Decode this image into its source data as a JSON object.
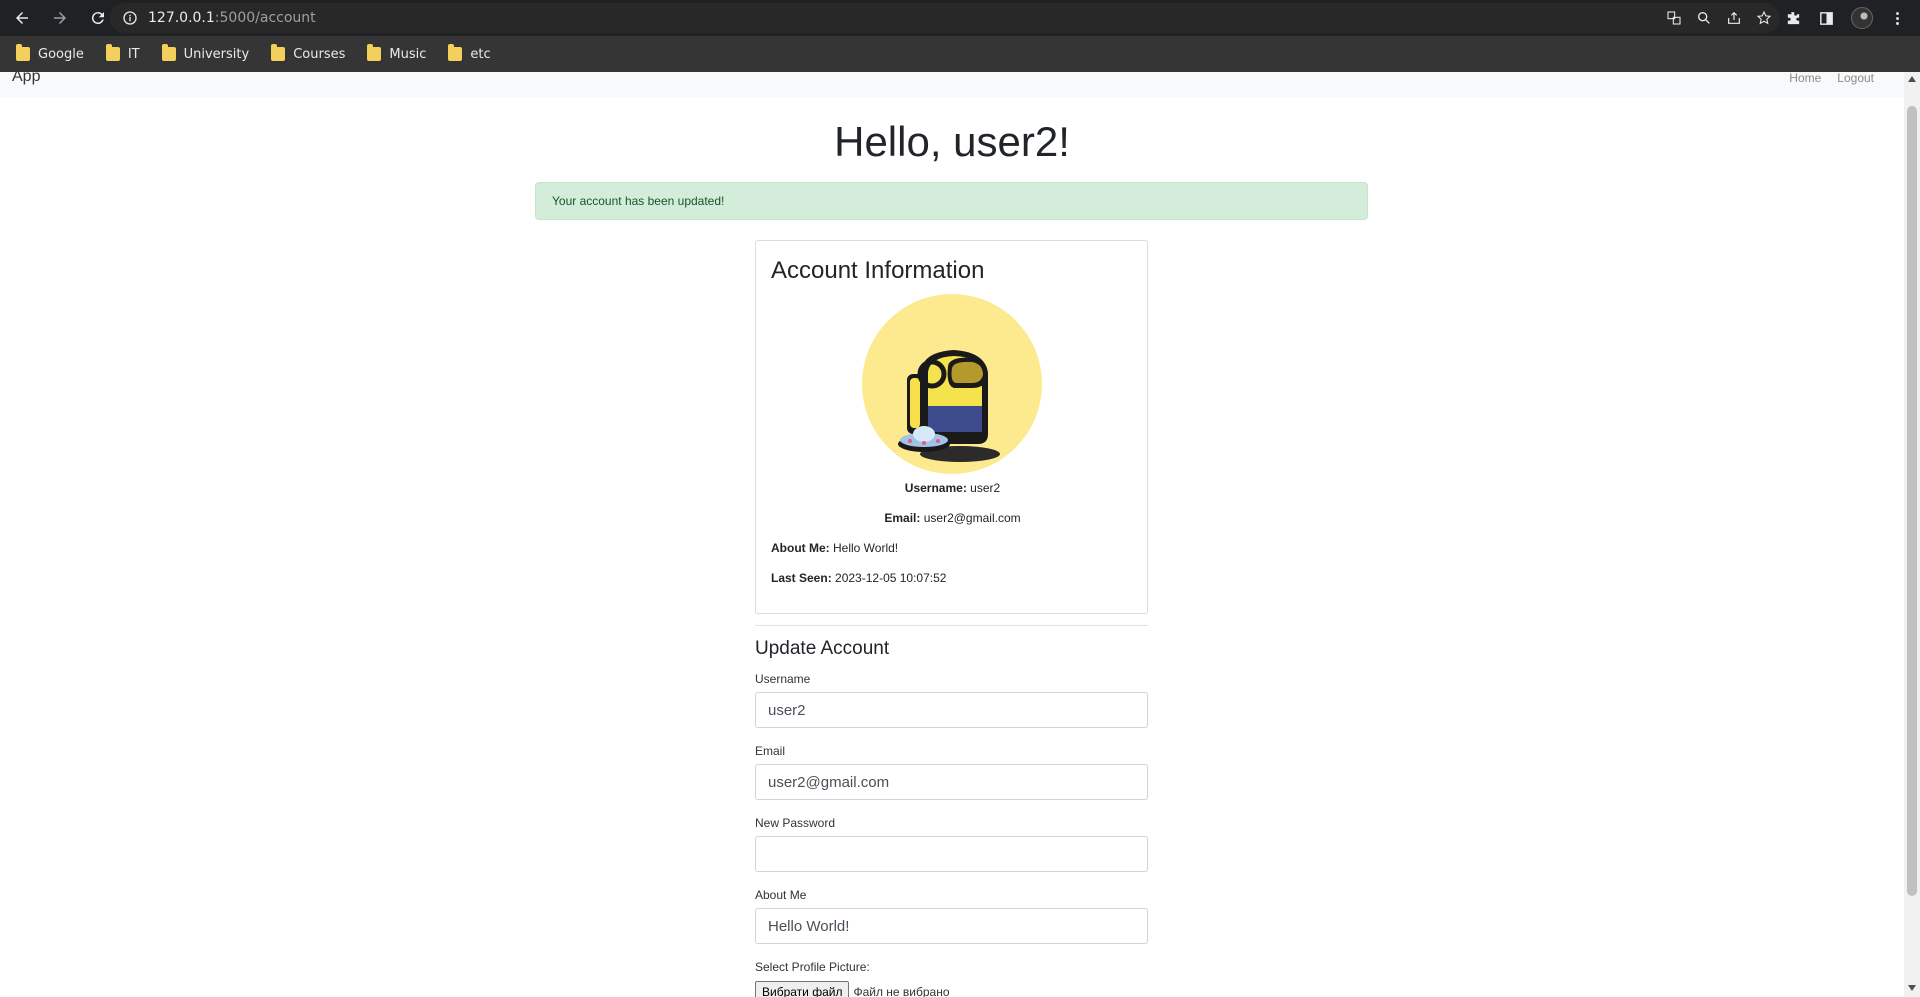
{
  "browser": {
    "url_host": "127.0.0.1",
    "url_rest": ":5000/account",
    "bookmarks": [
      {
        "label": "Google"
      },
      {
        "label": "IT"
      },
      {
        "label": "University"
      },
      {
        "label": "Courses"
      },
      {
        "label": "Music"
      },
      {
        "label": "etc"
      }
    ]
  },
  "navbar": {
    "brand": "App",
    "links": [
      "Home",
      "Logout"
    ]
  },
  "page": {
    "title": "Hello, user2!",
    "alert": "Your account has been updated!"
  },
  "account_card": {
    "title": "Account Information",
    "username_label": "Username:",
    "username_value": "user2",
    "email_label": "Email:",
    "email_value": "user2@gmail.com",
    "about_label": "About Me:",
    "about_value": "Hello World!",
    "last_seen_label": "Last Seen:",
    "last_seen_value": "2023-12-05 10:07:52"
  },
  "update_form": {
    "title": "Update Account",
    "username_label": "Username",
    "username_value": "user2",
    "email_label": "Email",
    "email_value": "user2@gmail.com",
    "password_label": "New Password",
    "password_value": "",
    "about_label": "About Me",
    "about_value": "Hello World!",
    "picture_label": "Select Profile Picture:",
    "file_button": "Вибрати файл",
    "file_status": "Файл не вибрано"
  },
  "colors": {
    "alert_bg": "#d4edda",
    "alert_text": "#155724",
    "avatar_bg": "#fde98e"
  }
}
